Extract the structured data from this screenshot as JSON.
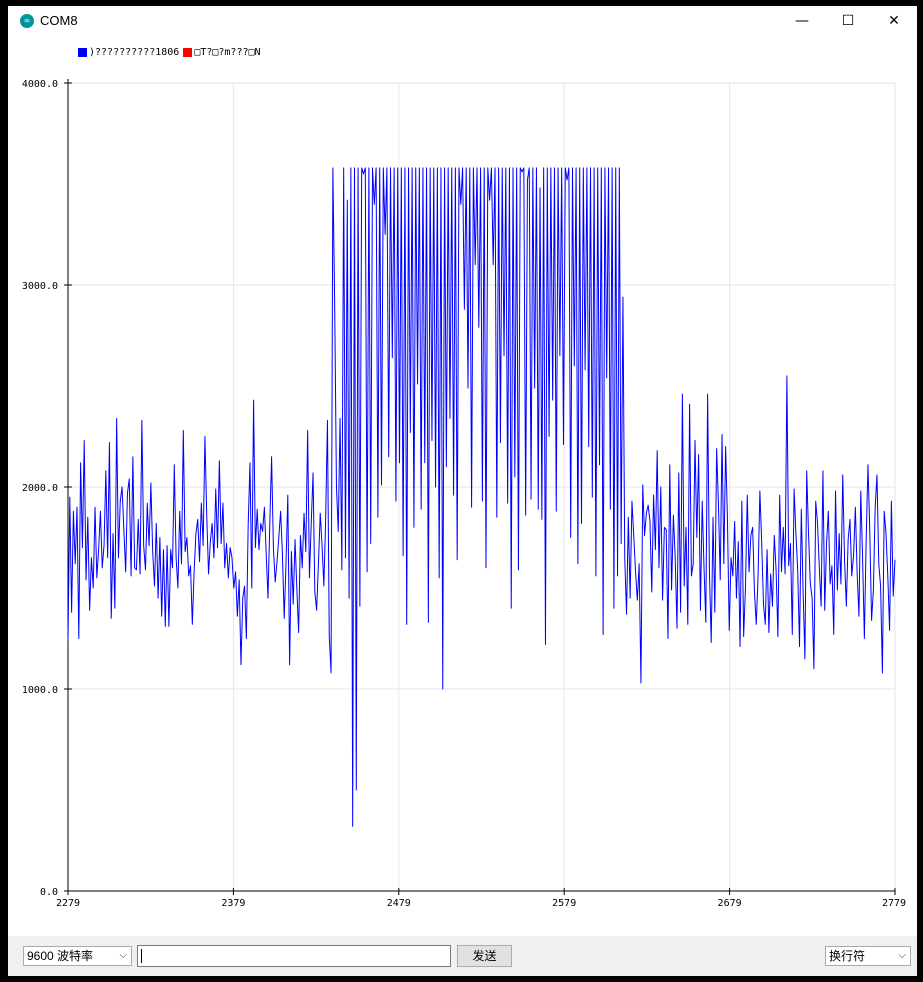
{
  "window": {
    "title": "COM8",
    "app_icon": "arduino-infinity-icon",
    "app_icon_glyph": "∞",
    "minimize_glyph": "—",
    "maximize_glyph": "☐",
    "close_glyph": "✕"
  },
  "legend": [
    {
      "label": ")??????????1806",
      "color": "#0000ff"
    },
    {
      "label": "□T?□?m???□N",
      "color": "#ff0000"
    }
  ],
  "bottom_bar": {
    "baud_rate": "9600  波特率",
    "send_label": "发送",
    "input_value": "",
    "line_ending": "换行符",
    "dropdown_glyph": "⌵"
  },
  "colors": {
    "series": "#0000ff",
    "axis": "#000000",
    "grid": "#e6e6e6"
  },
  "chart_data": {
    "type": "line",
    "title": "",
    "xlabel": "",
    "ylabel": "",
    "ylim": [
      0,
      4000
    ],
    "xlim": [
      2279,
      2779
    ],
    "y_ticks": [
      "4000.0",
      "3000.0",
      "2000.0",
      "1000.0",
      "0.0"
    ],
    "x_ticks": [
      "2279",
      "2379",
      "2479",
      "2579",
      "2679",
      "2779"
    ],
    "grid": true,
    "legend_position": "top-left",
    "series": [
      {
        "name": ")??????????1806",
        "color": "#0000ff",
        "x_start": 2279,
        "x_step": 1,
        "values": [
          1240,
          1950,
          1380,
          1880,
          1620,
          1900,
          1250,
          2120,
          1700,
          2230,
          1540,
          1850,
          1390,
          1650,
          1500,
          1900,
          1550,
          1690,
          1880,
          1600,
          1710,
          2080,
          1650,
          2220,
          1350,
          1770,
          1400,
          2340,
          1650,
          1930,
          2000,
          1790,
          1580,
          1970,
          2040,
          1560,
          2150,
          1600,
          1590,
          1840,
          1570,
          2330,
          1710,
          1590,
          1920,
          1710,
          2020,
          1680,
          1510,
          1820,
          1450,
          1750,
          1360,
          1690,
          1310,
          1710,
          1310,
          1690,
          1600,
          2110,
          1650,
          1500,
          1880,
          1620,
          2280,
          1680,
          1750,
          1560,
          1610,
          1320,
          1580,
          1770,
          1840,
          1630,
          1920,
          1710,
          2250,
          1860,
          1570,
          1730,
          1820,
          1650,
          1990,
          1700,
          2130,
          1720,
          1920,
          1600,
          1720,
          1550,
          1700,
          1650,
          1500,
          1580,
          1360,
          1540,
          1120,
          1450,
          1510,
          1250,
          1810,
          2120,
          1500,
          2430,
          1700,
          1890,
          1690,
          1820,
          1780,
          1900,
          1670,
          1450,
          1820,
          2150,
          1700,
          1530,
          1630,
          1750,
          1880,
          1670,
          1350,
          1620,
          1960,
          1120,
          1680,
          1420,
          1740,
          1500,
          1280,
          1760,
          1600,
          1870,
          1680,
          2280,
          1550,
          1820,
          2070,
          1480,
          1390,
          1620,
          1870,
          1710,
          1510,
          1840,
          2330,
          1260,
          1080,
          3580,
          2910,
          2000,
          1780,
          2340,
          1590,
          3580,
          1650,
          3420,
          1450,
          3580,
          320,
          3580,
          500,
          3580,
          1410,
          3580,
          3550,
          3580,
          1580,
          3580,
          1720,
          3580,
          3400,
          3580,
          1850,
          3580,
          2010,
          3580,
          3250,
          3580,
          2150,
          3580,
          2640,
          3580,
          1930,
          3580,
          2120,
          3580,
          1660,
          3580,
          1320,
          3580,
          2270,
          3580,
          1800,
          3580,
          2510,
          3580,
          1890,
          3580,
          2120,
          3580,
          1330,
          3580,
          2230,
          3580,
          2000,
          3580,
          1550,
          3580,
          1000,
          3580,
          2100,
          3580,
          2340,
          3580,
          1960,
          3580,
          1640,
          3580,
          3400,
          3580,
          2880,
          3580,
          2490,
          3580,
          1900,
          3580,
          3100,
          3580,
          2790,
          3580,
          1930,
          3580,
          1600,
          3580,
          3420,
          3580,
          3100,
          3580,
          1850,
          3580,
          2220,
          3580,
          2650,
          3580,
          1920,
          3580,
          1400,
          3580,
          2050,
          3580,
          1590,
          3580,
          3560,
          3580,
          1860,
          3520,
          3580,
          1940,
          3580,
          2490,
          3580,
          1890,
          3480,
          1840,
          3580,
          1220,
          3580,
          2250,
          3580,
          2430,
          3580,
          1880,
          3580,
          2650,
          3580,
          2210,
          3580,
          3520,
          3580,
          1750,
          3580,
          2600,
          3580,
          1620,
          3580,
          1820,
          3580,
          2580,
          3580,
          2200,
          3580,
          1950,
          3580,
          1560,
          3580,
          2110,
          3580,
          1270,
          3580,
          2540,
          3580,
          1890,
          3580,
          1400,
          3580,
          1560,
          3580,
          1720,
          2940,
          1650,
          1370,
          1850,
          1450,
          1930,
          1760,
          1580,
          1440,
          1620,
          1030,
          2010,
          1760,
          1870,
          1910,
          1830,
          1480,
          1960,
          1690,
          2180,
          1600,
          2000,
          1440,
          1800,
          1790,
          1250,
          2110,
          1490,
          1860,
          1650,
          1300,
          2070,
          1380,
          2460,
          1510,
          1800,
          1320,
          2410,
          1560,
          1620,
          2230,
          1750,
          2160,
          1390,
          1930,
          1600,
          1330,
          2460,
          1580,
          1230,
          1850,
          1380,
          2190,
          1920,
          1540,
          2260,
          1620,
          2200,
          1840,
          1290,
          1650,
          1560,
          1830,
          1450,
          1730,
          1210,
          1930,
          1260,
          1500,
          1960,
          1580,
          1760,
          1800,
          1480,
          1320,
          1560,
          1980,
          1730,
          1420,
          1320,
          1690,
          1280,
          1570,
          1410,
          1760,
          1590,
          1260,
          1960,
          1580,
          1800,
          1570,
          2550,
          1610,
          1720,
          1270,
          1990,
          1770,
          1590,
          1210,
          1890,
          1480,
          1150,
          2080,
          1770,
          1520,
          1450,
          1100,
          1930,
          1820,
          1600,
          1410,
          2080,
          1390,
          1720,
          1880,
          1520,
          1610,
          1270,
          1980,
          1490,
          1770,
          1520,
          2060,
          1640,
          1410,
          1740,
          1840,
          1560,
          1660,
          1900,
          1570,
          1360,
          1980,
          1650,
          1250,
          1740,
          2110,
          1780,
          1340,
          1490,
          1900,
          2060,
          1620,
          1510,
          1080,
          1880,
          1770,
          1560,
          1290,
          1930,
          1460,
          1640
        ]
      },
      {
        "name": "□T?□?m???□N",
        "color": "#ff0000",
        "values": []
      }
    ]
  }
}
